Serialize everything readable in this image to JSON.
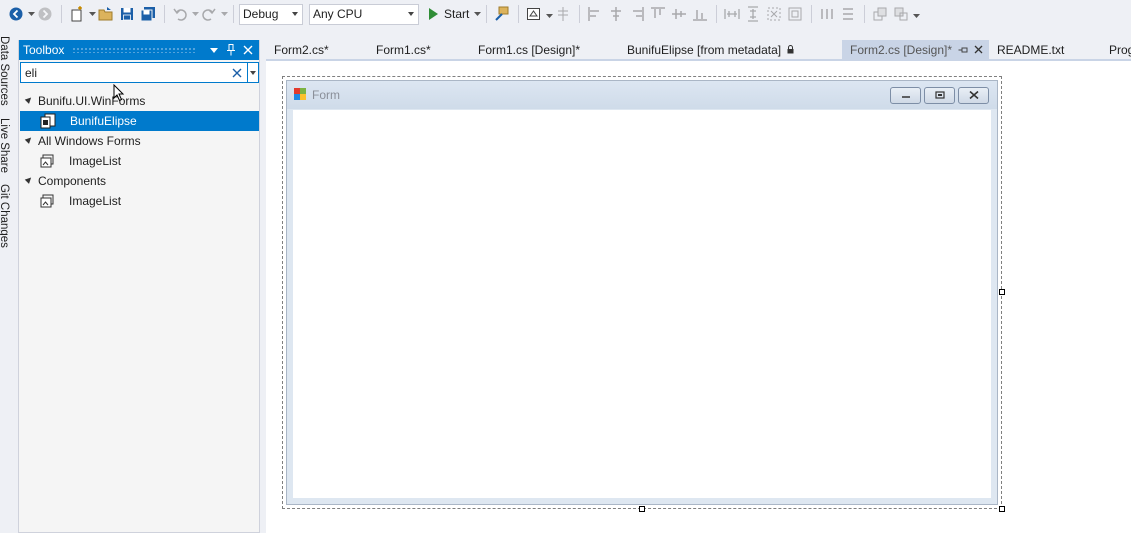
{
  "toolbar": {
    "config": "Debug",
    "platform": "Any CPU",
    "start_label": "Start"
  },
  "side_tabs": [
    "Data Sources",
    "Live Share",
    "Git Changes"
  ],
  "toolbox": {
    "title": "Toolbox",
    "search_value": "eli",
    "groups": [
      {
        "label": "Bunifu.UI.WinForms",
        "items": [
          {
            "label": "BunifuElipse",
            "selected": true
          }
        ]
      },
      {
        "label": "All Windows Forms",
        "items": [
          {
            "label": "ImageList",
            "selected": false
          }
        ]
      },
      {
        "label": "Components",
        "items": [
          {
            "label": "ImageList",
            "selected": false
          }
        ]
      }
    ]
  },
  "tabs": [
    {
      "label": "Form2.cs*"
    },
    {
      "label": "Form1.cs*"
    },
    {
      "label": "Form1.cs [Design]*"
    },
    {
      "label": "BunifuElipse [from metadata]"
    },
    {
      "label": "Form2.cs [Design]*"
    },
    {
      "label": "README.txt"
    },
    {
      "label": "Prog"
    }
  ],
  "designer": {
    "form_title": "Form"
  },
  "colors": {
    "accent": "#007acc",
    "active_tab": "#c9d4e6",
    "background": "#eef0f5"
  }
}
